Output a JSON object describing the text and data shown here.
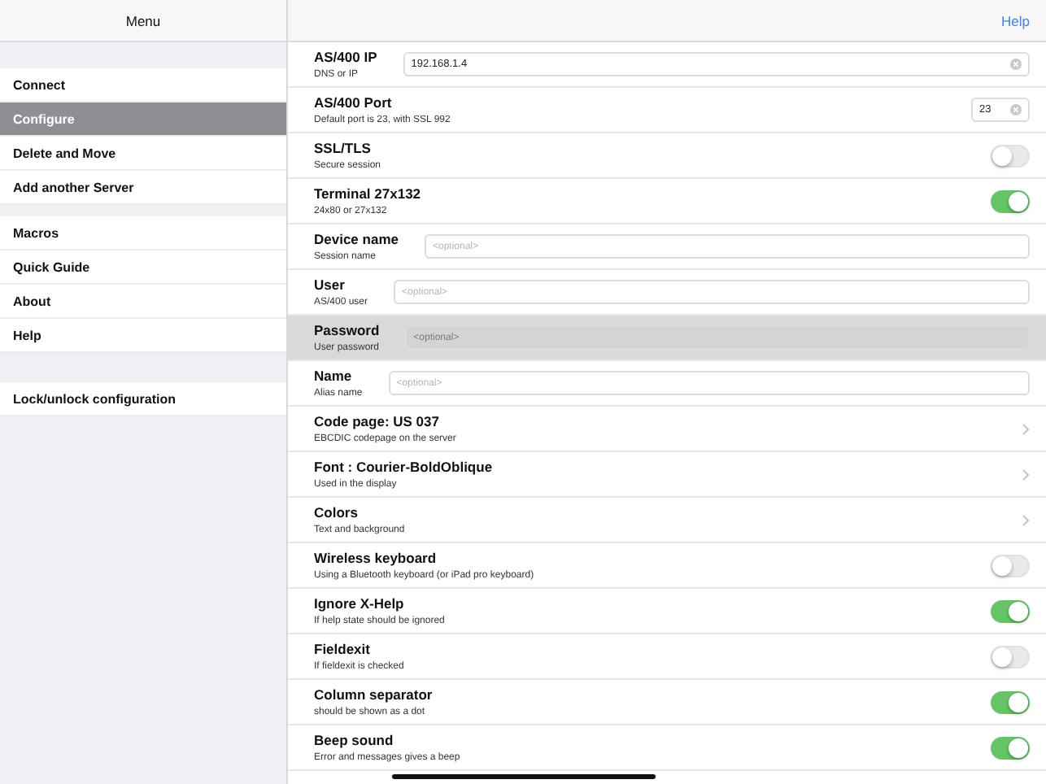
{
  "menu": {
    "title": "Menu",
    "groups": [
      [
        {
          "label": "Connect",
          "selected": false
        },
        {
          "label": "Configure",
          "selected": true
        },
        {
          "label": "Delete and Move",
          "selected": false
        },
        {
          "label": "Add another Server",
          "selected": false
        }
      ],
      [
        {
          "label": "Macros",
          "selected": false
        },
        {
          "label": "Quick Guide",
          "selected": false
        },
        {
          "label": "About",
          "selected": false
        },
        {
          "label": "Help",
          "selected": false
        }
      ],
      [
        {
          "label": "Lock/unlock configuration",
          "selected": false
        }
      ]
    ]
  },
  "settings": {
    "help_link": "Help",
    "rows": [
      {
        "kind": "text-field",
        "title": "AS/400 IP",
        "subtitle": "DNS or IP",
        "value": "192.168.1.4",
        "selected": false
      },
      {
        "kind": "short-field",
        "title": "AS/400 Port",
        "subtitle": "Default port is 23, with SSL 992",
        "value": "23",
        "selected": false
      },
      {
        "kind": "toggle",
        "title": "SSL/TLS",
        "subtitle": "Secure session",
        "on": false,
        "selected": false
      },
      {
        "kind": "toggle",
        "title": "Terminal 27x132",
        "subtitle": "24x80 or 27x132",
        "on": true,
        "selected": false
      },
      {
        "kind": "text-field",
        "title": "Device name",
        "subtitle": "Session name",
        "placeholder": "<optional>",
        "selected": false
      },
      {
        "kind": "text-field",
        "title": "User",
        "subtitle": "AS/400 user",
        "placeholder": "<optional>",
        "selected": false
      },
      {
        "kind": "text-field",
        "title": "Password",
        "subtitle": "User password",
        "placeholder": "<optional>",
        "selected": true
      },
      {
        "kind": "text-field",
        "title": "Name",
        "subtitle": "Alias name",
        "placeholder": "<optional>",
        "selected": false
      },
      {
        "kind": "disclosure",
        "title": "Code page: US  037",
        "subtitle": "EBCDIC codepage on the server",
        "selected": false
      },
      {
        "kind": "disclosure",
        "title": "Font : Courier-BoldOblique",
        "subtitle": "Used in the display",
        "selected": false
      },
      {
        "kind": "disclosure",
        "title": "Colors",
        "subtitle": "Text and background",
        "selected": false
      },
      {
        "kind": "toggle",
        "title": "Wireless keyboard",
        "subtitle": "Using a Bluetooth keyboard (or iPad pro keyboard)",
        "on": false,
        "selected": false
      },
      {
        "kind": "toggle",
        "title": "Ignore X-Help",
        "subtitle": "If help state should be ignored",
        "on": true,
        "selected": false
      },
      {
        "kind": "toggle",
        "title": "Fieldexit",
        "subtitle": "If fieldexit is checked",
        "on": false,
        "selected": false
      },
      {
        "kind": "toggle",
        "title": "Column separator",
        "subtitle": "should be shown as a dot",
        "on": true,
        "selected": false
      },
      {
        "kind": "toggle",
        "title": "Beep sound",
        "subtitle": "Error and messages gives a beep",
        "on": true,
        "selected": false
      }
    ]
  }
}
